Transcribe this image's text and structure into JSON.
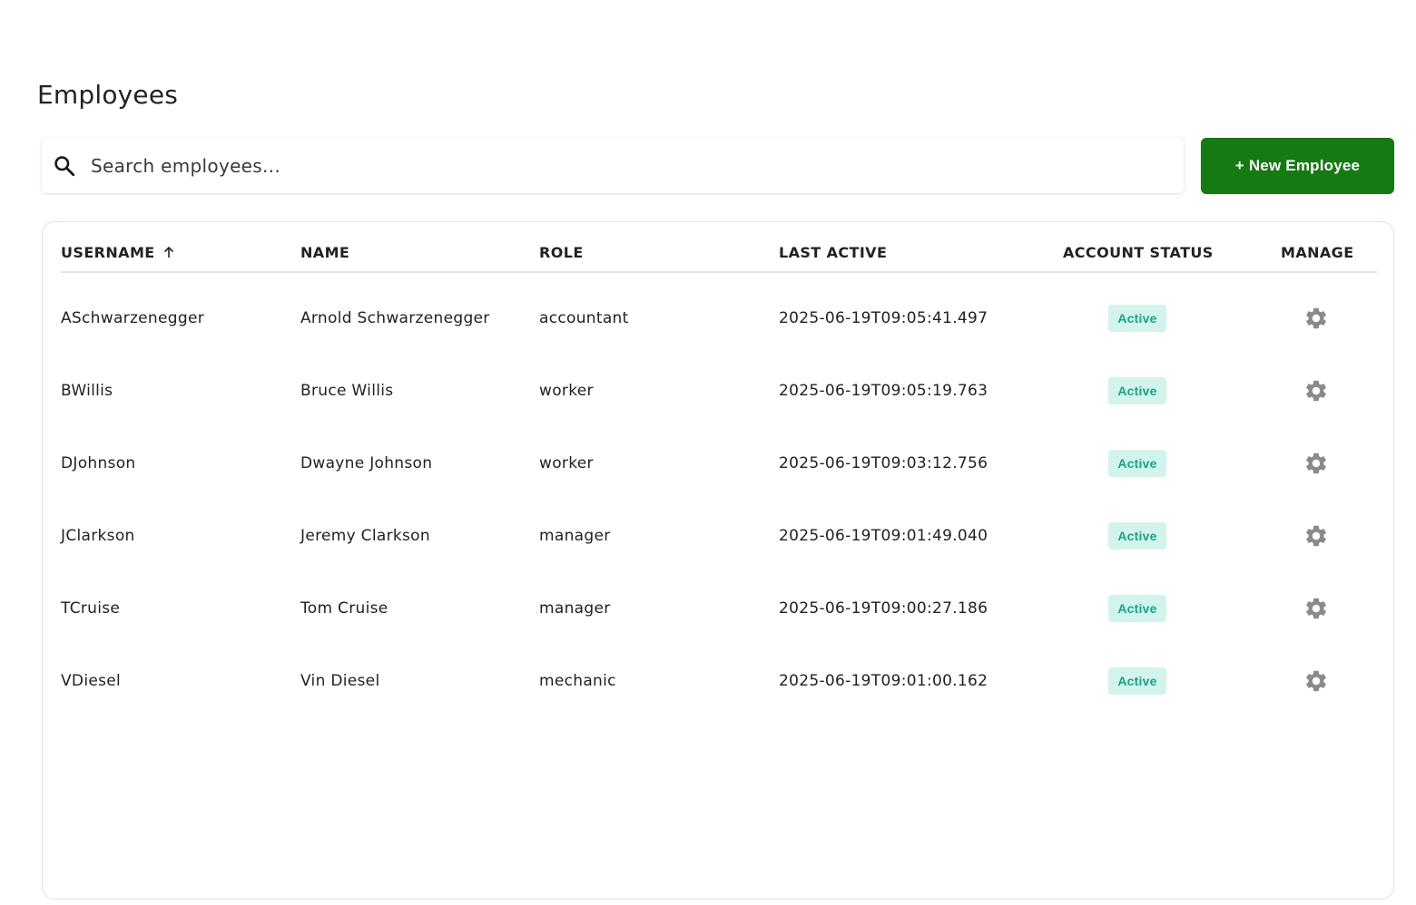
{
  "page": {
    "title": "Employees"
  },
  "search": {
    "placeholder": "Search employees...",
    "value": ""
  },
  "toolbar": {
    "new_employee_label": "+ New Employee"
  },
  "table": {
    "columns": {
      "username": "USERNAME",
      "name": "NAME",
      "role": "ROLE",
      "last_active": "LAST ACTIVE",
      "account_status": "ACCOUNT STATUS",
      "manage": "MANAGE"
    },
    "sort": {
      "column": "username",
      "direction": "ascending",
      "icon": "arrow-up-icon"
    },
    "rows": [
      {
        "username": "ASchwarzenegger",
        "name": "Arnold Schwarzenegger",
        "role": "accountant",
        "last_active": "2025-06-19T09:05:41.497",
        "status": "Active"
      },
      {
        "username": "BWillis",
        "name": "Bruce Willis",
        "role": "worker",
        "last_active": "2025-06-19T09:05:19.763",
        "status": "Active"
      },
      {
        "username": "DJohnson",
        "name": "Dwayne Johnson",
        "role": "worker",
        "last_active": "2025-06-19T09:03:12.756",
        "status": "Active"
      },
      {
        "username": "JClarkson",
        "name": "Jeremy Clarkson",
        "role": "manager",
        "last_active": "2025-06-19T09:01:49.040",
        "status": "Active"
      },
      {
        "username": "TCruise",
        "name": "Tom Cruise",
        "role": "manager",
        "last_active": "2025-06-19T09:00:27.186",
        "status": "Active"
      },
      {
        "username": "VDiesel",
        "name": "Vin Diesel",
        "role": "mechanic",
        "last_active": "2025-06-19T09:01:00.162",
        "status": "Active"
      }
    ]
  },
  "colors": {
    "primary_button": "#157a12",
    "status_badge_bg": "#d3f4ec",
    "status_badge_text": "#14a683",
    "gear_icon": "#8a8a8a"
  },
  "icons": {
    "search": "search-icon",
    "manage": "gear-icon"
  }
}
